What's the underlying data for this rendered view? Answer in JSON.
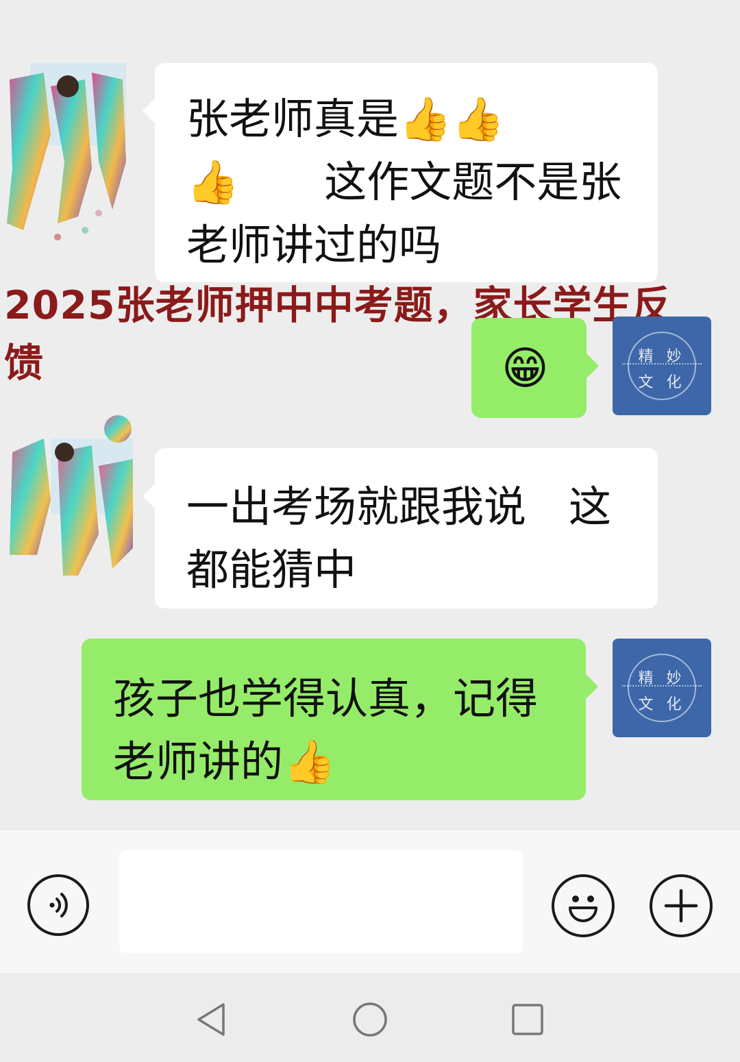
{
  "messages": [
    {
      "side": "left",
      "lines": [
        "张老师真是👍👍",
        "👍　　这作文题不是张",
        "老师讲过的吗"
      ]
    },
    {
      "side": "right",
      "lines": [
        "😁"
      ]
    },
    {
      "side": "left",
      "lines": [
        "一出考场就跟我说　这",
        "都能猜中"
      ]
    },
    {
      "side": "right",
      "lines": [
        "孩子也学得认真，记得",
        "老师讲的👍"
      ]
    }
  ],
  "overlay": {
    "caption_line1": "2025张老师押中中考题，家长学生反",
    "caption_line2": "馈"
  },
  "self_avatar": {
    "text_top": "精 妙",
    "text_bottom": "文 化",
    "color": "#3d67a8"
  },
  "input_bar": {
    "voice_icon": "voice-icon",
    "emoji_icon": "emoji-icon",
    "plus_icon": "plus-icon",
    "input_value": ""
  },
  "nav_bar": {
    "back_icon": "triangle-back-icon",
    "home_icon": "circle-home-icon",
    "recents_icon": "square-recents-icon"
  },
  "colors": {
    "chat_background": "#ededed",
    "left_bubble": "#ffffff",
    "right_bubble": "#95ec69",
    "caption": "#8b1a1a"
  }
}
